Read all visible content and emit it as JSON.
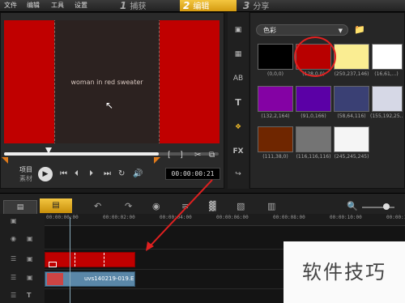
{
  "menu": [
    "文件",
    "编辑",
    "工具",
    "设置"
  ],
  "steps": [
    {
      "num": "1",
      "label": "捕获",
      "active": false
    },
    {
      "num": "2",
      "label": "编辑",
      "active": true
    },
    {
      "num": "3",
      "label": "分享",
      "active": false
    }
  ],
  "player": {
    "project_label": "项目",
    "clip_label": "素材",
    "timecode": "00:00:00:21",
    "scrub_progress": 0.72,
    "bracket_in": "[",
    "bracket_out": "]"
  },
  "library": {
    "category": "色彩",
    "swatches": [
      {
        "label": "(0,0,0)",
        "color": "#000000"
      },
      {
        "label": "(128,0,0)",
        "color": "#b80000"
      },
      {
        "label": "(250,237,146)",
        "color": "#faed92"
      },
      {
        "label": "(16,61,...)",
        "color": "#ffffff"
      },
      {
        "label": "(132,2,164)",
        "color": "#8402a4"
      },
      {
        "label": "(91,0,166)",
        "color": "#5b00a6"
      },
      {
        "label": "(58,64,116)",
        "color": "#3a4074"
      },
      {
        "label": "(155,192,25...)",
        "color": "#d6d8e6"
      },
      {
        "label": "(111,38,0)",
        "color": "#6f2600"
      },
      {
        "label": "(116,116,116)",
        "color": "#747474"
      },
      {
        "label": "(245,245,245)",
        "color": "#f5f5f5"
      }
    ]
  },
  "timeline": {
    "ruler_ticks": [
      "00:00:00:00",
      "00:00:02:00",
      "00:00:04:00",
      "00:00:06:00",
      "00:00:08:00",
      "00:00:10:00",
      "00:00:12:00"
    ],
    "video_clip_name": "uvs140219-019.E"
  },
  "watermark": "软件技巧"
}
